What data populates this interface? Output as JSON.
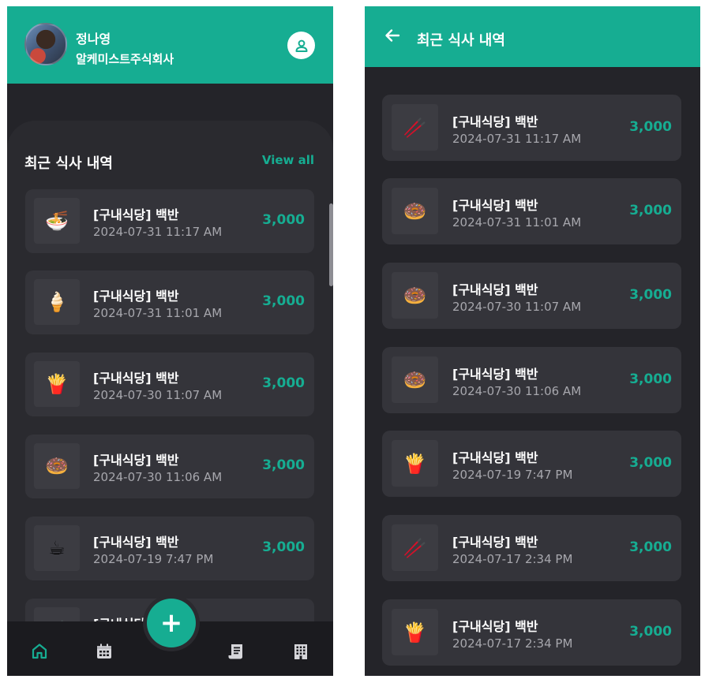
{
  "left_screen": {
    "user": {
      "name": "정나영",
      "company": "알케미스트주식회사"
    },
    "section_title": "최근 식사 내역",
    "view_all_label": "View all",
    "meals": [
      {
        "icon": "noodle-bowl-icon",
        "glyph": "🍜",
        "title": "[구내식당] 백반",
        "time": "2024-07-31 11:17 AM",
        "amount": "3,000"
      },
      {
        "icon": "ice-cream-icon",
        "glyph": "🍦",
        "title": "[구내식당] 백반",
        "time": "2024-07-31 11:01 AM",
        "amount": "3,000"
      },
      {
        "icon": "french-fries-icon",
        "glyph": "🍟",
        "title": "[구내식당] 백반",
        "time": "2024-07-30 11:07 AM",
        "amount": "3,000"
      },
      {
        "icon": "donut-icon",
        "glyph": "🍩",
        "title": "[구내식당] 백반",
        "time": "2024-07-30 11:06 AM",
        "amount": "3,000"
      },
      {
        "icon": "coffee-cup-icon",
        "glyph": "☕",
        "title": "[구내식당] 백반",
        "time": "2024-07-19 7:47 PM",
        "amount": "3,000"
      },
      {
        "icon": "chopsticks-icon",
        "glyph": "🥢",
        "title": "[구내식당]",
        "time": "",
        "amount": ""
      }
    ],
    "fab_label": "+",
    "nav": [
      "home-icon",
      "calendar-icon",
      "receipt-icon",
      "building-icon"
    ]
  },
  "right_screen": {
    "title": "최근 식사 내역",
    "meals": [
      {
        "icon": "chopsticks-icon",
        "glyph": "🥢",
        "title": "[구내식당] 백반",
        "time": "2024-07-31 11:17 AM",
        "amount": "3,000"
      },
      {
        "icon": "donut-icon",
        "glyph": "🍩",
        "title": "[구내식당] 백반",
        "time": "2024-07-31 11:01 AM",
        "amount": "3,000"
      },
      {
        "icon": "donut-icon",
        "glyph": "🍩",
        "title": "[구내식당] 백반",
        "time": "2024-07-30 11:07 AM",
        "amount": "3,000"
      },
      {
        "icon": "donut-icon",
        "glyph": "🍩",
        "title": "[구내식당] 백반",
        "time": "2024-07-30 11:06 AM",
        "amount": "3,000"
      },
      {
        "icon": "french-fries-icon",
        "glyph": "🍟",
        "title": "[구내식당] 백반",
        "time": "2024-07-19 7:47 PM",
        "amount": "3,000"
      },
      {
        "icon": "chopsticks-icon",
        "glyph": "🥢",
        "title": "[구내식당] 백반",
        "time": "2024-07-17 2:34 PM",
        "amount": "3,000"
      },
      {
        "icon": "french-fries-icon",
        "glyph": "🍟",
        "title": "[구내식당] 백반",
        "time": "2024-07-17 2:34 PM",
        "amount": "3,000"
      }
    ]
  },
  "colors": {
    "accent": "#16ad92",
    "background": "#242429",
    "card": "#34343a"
  }
}
